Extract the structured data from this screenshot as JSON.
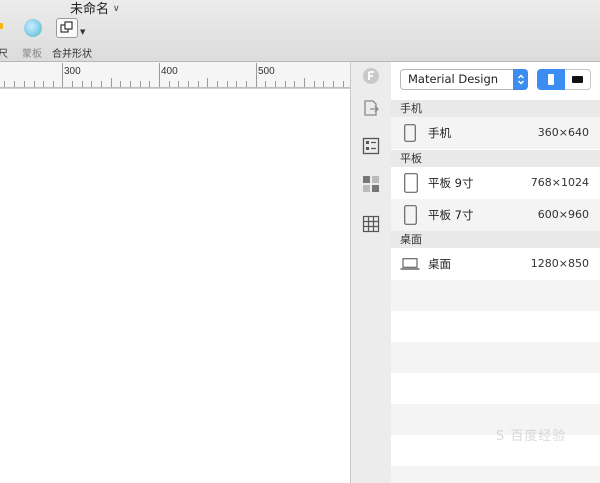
{
  "window": {
    "document_title": "未命名"
  },
  "toolbar": {
    "ruler_label": "标尺",
    "mask_label": "蒙板",
    "combine_label": "合并形状"
  },
  "ruler": {
    "ticks": [
      "300",
      "400",
      "500"
    ]
  },
  "presets": {
    "selected": "Material Design",
    "groups": [
      {
        "label": "手机",
        "devices": [
          {
            "name": "手机",
            "size": "360×640"
          }
        ]
      },
      {
        "label": "平板",
        "devices": [
          {
            "name": "平板 9寸",
            "size": "768×1024"
          },
          {
            "name": "平板 7寸",
            "size": "600×960"
          }
        ]
      },
      {
        "label": "桌面",
        "devices": [
          {
            "name": "桌面",
            "size": "1280×850"
          }
        ]
      }
    ]
  },
  "colors": {
    "accent": "#3b8df2",
    "toolbar_bg": "#dcdcdc",
    "group_header_bg": "#e9e9e9"
  },
  "watermark": "S 百度经验"
}
